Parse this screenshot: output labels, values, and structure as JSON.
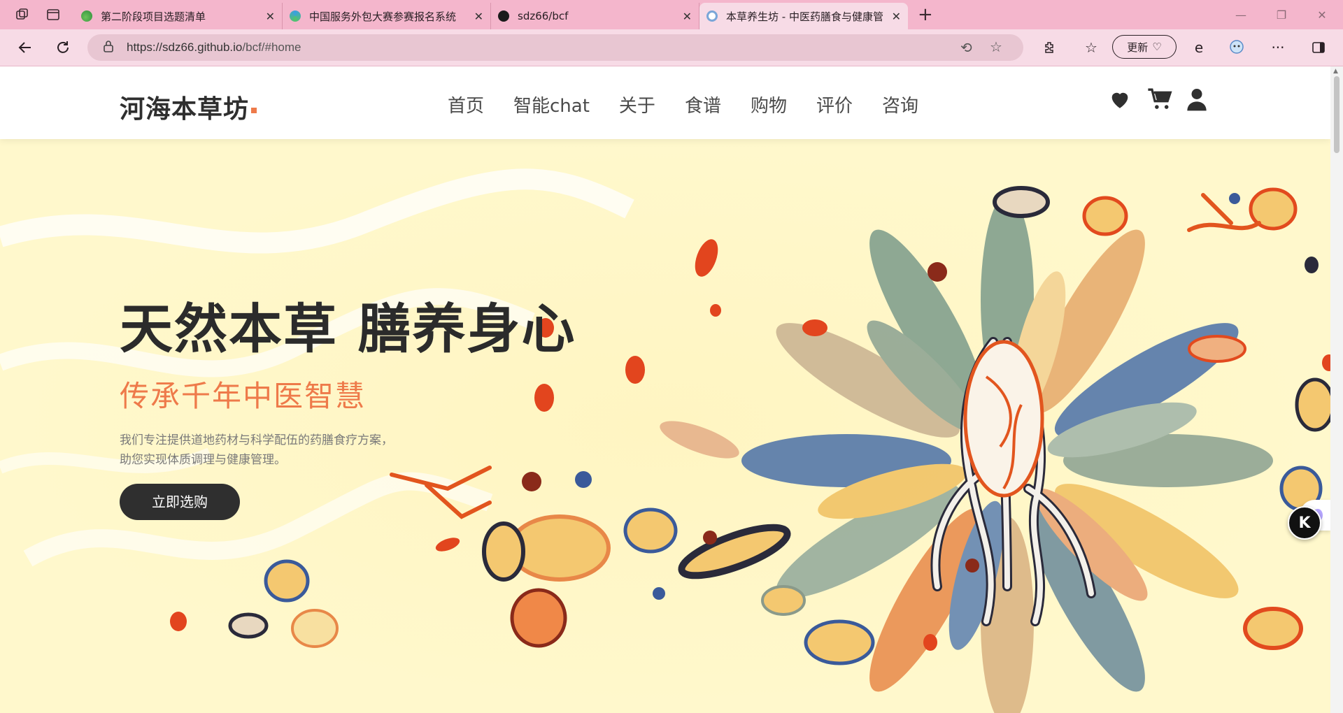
{
  "browser": {
    "tabs": [
      {
        "title": "第二阶段项目选题清单",
        "favicon": "green-leaf-icon",
        "active": false
      },
      {
        "title": "中国服务外包大赛参赛报名系统",
        "favicon": "blue-logo-icon",
        "active": false
      },
      {
        "title": "sdz66/bcf",
        "favicon": "github-icon",
        "active": false
      },
      {
        "title": "本草养生坊 - 中医药膳食与健康管",
        "favicon": "gear-favicon-icon",
        "active": true
      }
    ],
    "url_host": "https://sdz66.github.io",
    "url_path": "/bcf/#home",
    "update_label": "更新",
    "accent": "#f4b6cc"
  },
  "site": {
    "logo": "河海本草坊",
    "nav": [
      "首页",
      "智能chat",
      "关于",
      "食谱",
      "购物",
      "评价",
      "咨询"
    ],
    "header_icons": [
      "heart-icon",
      "cart-icon",
      "user-icon"
    ]
  },
  "hero": {
    "title": "天然本草 膳养身心",
    "subtitle": "传承千年中医智慧",
    "desc_line1": "我们专注提供道地药材与科学配伍的药膳食疗方案，",
    "desc_line2": "助您实现体质调理与健康管理。",
    "cta": "立即选购",
    "accent": "#ee7a4a"
  },
  "floating": {
    "k_label": "K"
  }
}
